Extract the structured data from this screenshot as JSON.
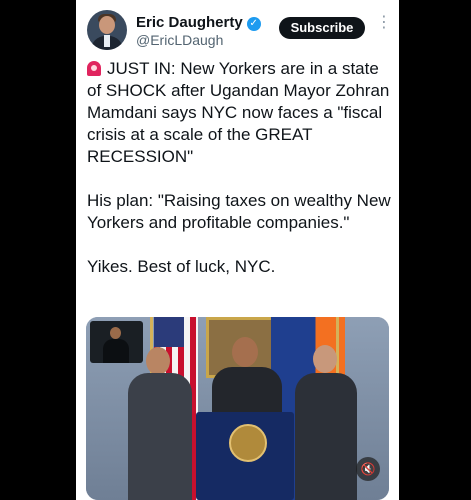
{
  "tweet": {
    "author_name": "Eric Daugherty",
    "handle": "@EricLDaugh",
    "subscribe_label": "Subscribe",
    "more_label": "⋮",
    "verified_label": "✓",
    "paragraphs": [
      "JUST IN: New Yorkers are in a state of SHOCK after Ugandan Mayor Zohran Mamdani says NYC now faces a \"fiscal crisis at a scale of the GREAT RECESSION\"",
      "His plan: \"Raising taxes on wealthy New Yorkers and profitable companies.\"",
      "Yikes. Best of luck, NYC."
    ],
    "media": {
      "mute_icon_label": "🔇"
    }
  }
}
